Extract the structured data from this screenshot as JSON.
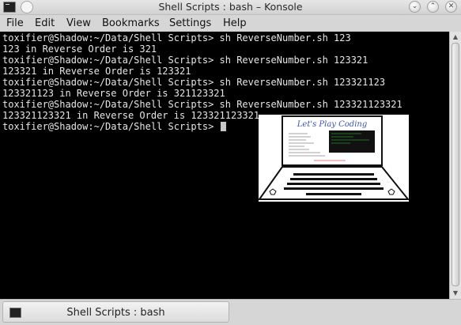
{
  "window": {
    "title": "Shell Scripts : bash – Konsole"
  },
  "menu": [
    "File",
    "Edit",
    "View",
    "Bookmarks",
    "Settings",
    "Help"
  ],
  "terminal": {
    "lines": [
      "toxifier@Shadow:~/Data/Shell Scripts> sh ReverseNumber.sh 123",
      "123 in Reverse Order is 321",
      "toxifier@Shadow:~/Data/Shell Scripts> sh ReverseNumber.sh 123321",
      "123321 in Reverse Order is 123321",
      "toxifier@Shadow:~/Data/Shell Scripts> sh ReverseNumber.sh 123321123",
      "123321123 in Reverse Order is 321123321",
      "toxifier@Shadow:~/Data/Shell Scripts> sh ReverseNumber.sh 123321123321",
      "123321123321 in Reverse Order is 123321123321",
      "toxifier@Shadow:~/Data/Shell Scripts> "
    ]
  },
  "tab": {
    "label": "Shell Scripts : bash"
  },
  "logo": {
    "text": "Let's Play Coding"
  },
  "colors": {
    "terminal_bg": "#000000",
    "terminal_fg": "#e6e6e6",
    "logo_title": "#3a55b8"
  }
}
